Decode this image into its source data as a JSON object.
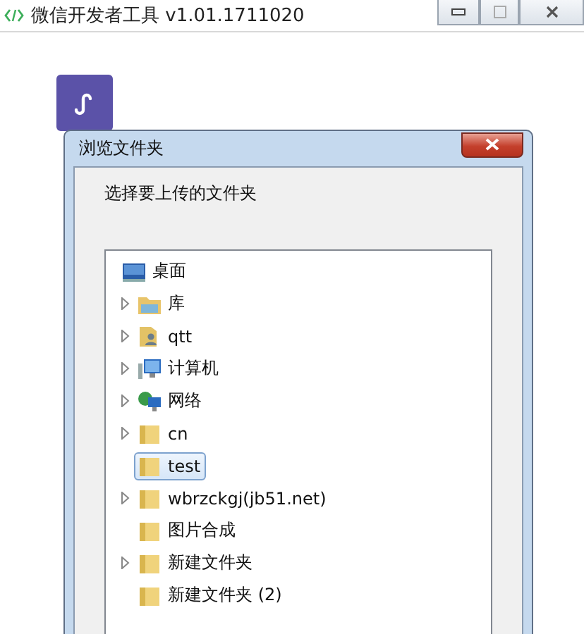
{
  "window": {
    "title": "微信开发者工具 v1.01.1711020"
  },
  "dialog": {
    "title": "浏览文件夹",
    "instruction": "选择要上传的文件夹",
    "tree": [
      {
        "label": "桌面",
        "kind": "desktop",
        "selected": false,
        "children": [
          {
            "label": "库",
            "kind": "library",
            "expandable": true,
            "selected": false
          },
          {
            "label": "qtt",
            "kind": "user",
            "expandable": true,
            "selected": false
          },
          {
            "label": "计算机",
            "kind": "computer",
            "expandable": true,
            "selected": false
          },
          {
            "label": "网络",
            "kind": "network",
            "expandable": true,
            "selected": false
          },
          {
            "label": "cn",
            "kind": "folder",
            "expandable": true,
            "selected": false
          },
          {
            "label": "test",
            "kind": "folder",
            "expandable": false,
            "selected": true
          },
          {
            "label": "wbrzckgj(jb51.net)",
            "kind": "folder",
            "expandable": true,
            "selected": false
          },
          {
            "label": "图片合成",
            "kind": "folder",
            "expandable": false,
            "selected": false
          },
          {
            "label": "新建文件夹",
            "kind": "folder",
            "expandable": true,
            "selected": false
          },
          {
            "label": "新建文件夹 (2)",
            "kind": "folder",
            "expandable": false,
            "selected": false
          }
        ]
      }
    ]
  }
}
